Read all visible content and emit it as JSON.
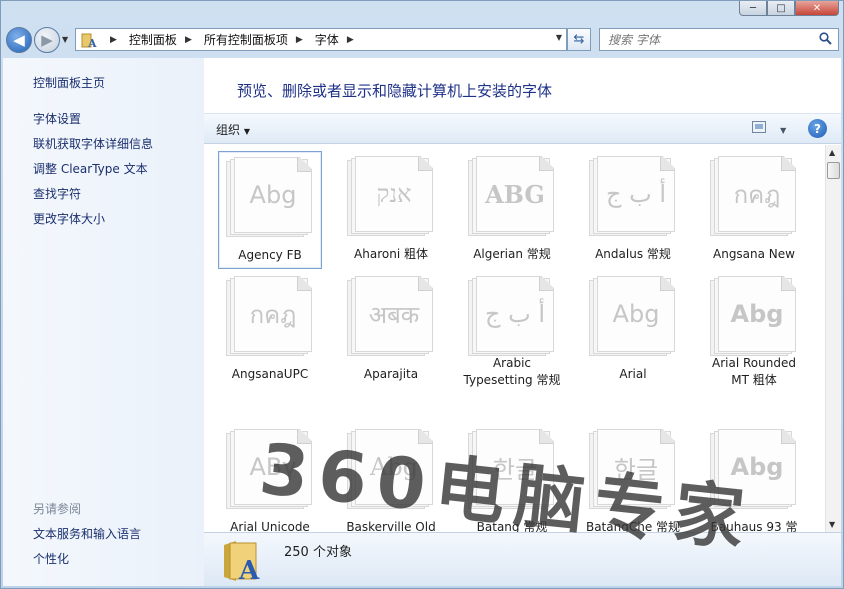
{
  "window": {
    "controls": [
      "─",
      "□",
      "✕"
    ]
  },
  "address": {
    "crumbs": [
      "控制面板",
      "所有控制面板项",
      "字体"
    ],
    "search_placeholder": "搜索 字体"
  },
  "sidebar": {
    "home": "控制面板主页",
    "items": [
      "字体设置",
      "联机获取字体详细信息",
      "调整 ClearType 文本",
      "查找字符",
      "更改字体大小"
    ],
    "see_also_title": "另请参阅",
    "see_also": [
      "文本服务和输入语言",
      "个性化"
    ]
  },
  "main": {
    "title": "预览、删除或者显示和隐藏计算机上安装的字体",
    "organize": "组织",
    "help": "?",
    "fonts": [
      {
        "name": "Agency FB",
        "sample": "Abg",
        "selected": true
      },
      {
        "name": "Aharoni 粗体",
        "sample": "אנק"
      },
      {
        "name": "Algerian 常规",
        "sample": "ABG"
      },
      {
        "name": "Andalus 常规",
        "sample": "أ ب ج"
      },
      {
        "name": "Angsana New",
        "sample": "กคฎ"
      },
      {
        "name": "AngsanaUPC",
        "sample": "กคฎ"
      },
      {
        "name": "Aparajita",
        "sample": "अबक"
      },
      {
        "name": "Arabic Typesetting 常规",
        "sample": "أ ب ج"
      },
      {
        "name": "Arial",
        "sample": "Abg"
      },
      {
        "name": "Arial Rounded MT 粗体",
        "sample": "Abg"
      },
      {
        "name": "Arial Unicode",
        "sample": "AΒγ"
      },
      {
        "name": "Baskerville Old",
        "sample": "Abg"
      },
      {
        "name": "Batang 常规",
        "sample": "한글"
      },
      {
        "name": "BatangChe 常规",
        "sample": "한글"
      },
      {
        "name": "Bauhaus 93 常",
        "sample": "Abg"
      }
    ],
    "status_count": "250 个对象"
  },
  "watermark": "360电脑专家"
}
